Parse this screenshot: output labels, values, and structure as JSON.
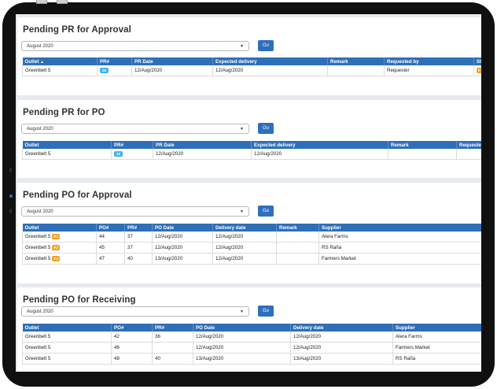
{
  "sections": [
    {
      "title": "Pending PR for Approval",
      "select_value": "August 2020",
      "go_label": "Go",
      "columns": [
        "Outlet",
        "PR#",
        "PR Date",
        "Expected delivery",
        "Remark",
        "Requested by",
        "Sta"
      ],
      "sort_arrow": "▲",
      "rows": [
        {
          "outlet": "Greenbelt 5",
          "pr_badge": "28",
          "pr_date": "12/Aug/2020",
          "expected": "12/Aug/2020",
          "remark": "",
          "requested_by": "Requester",
          "status_badge": "P"
        }
      ]
    },
    {
      "title": "Pending PR for PO",
      "select_value": "August 2020",
      "go_label": "Go",
      "columns": [
        "Outlet",
        "PR#",
        "PR Date",
        "Expected delivery",
        "Remark",
        "Requester"
      ],
      "rows": [
        {
          "outlet": "Greenbelt 5",
          "pr_badge": "28",
          "pr_date": "12/Aug/2020",
          "expected": "12/Aug/2020",
          "remark": "",
          "requester": ""
        }
      ]
    },
    {
      "title": "Pending PO for Approval",
      "select_value": "August 2020",
      "go_label": "Go",
      "columns": [
        "Outlet",
        "PO#",
        "PR#",
        "PO Date",
        "Delivery date",
        "Remark",
        "Supplier"
      ],
      "rows": [
        {
          "outlet": "Greenbelt 5",
          "badge": "PJ",
          "po": "44",
          "pr": "37",
          "po_date": "12/Aug/2020",
          "delivery": "12/Aug/2020",
          "remark": "",
          "supplier": "Alera Farms"
        },
        {
          "outlet": "Greenbelt 5",
          "badge": "PJ",
          "po": "45",
          "pr": "37",
          "po_date": "12/Aug/2020",
          "delivery": "12/Aug/2020",
          "remark": "",
          "supplier": "RS Raña"
        },
        {
          "outlet": "Greenbelt 5",
          "badge": "PJ",
          "po": "47",
          "pr": "40",
          "po_date": "13/Aug/2020",
          "delivery": "12/Aug/2020",
          "remark": "",
          "supplier": "Farmers Market"
        }
      ]
    },
    {
      "title": "Pending PO for Receiving",
      "select_value": "August 2020",
      "go_label": "Go",
      "columns": [
        "Outlet",
        "PO#",
        "PR#",
        "PO Date",
        "Delivery date",
        "Supplier"
      ],
      "rows": [
        {
          "outlet": "Greenbelt 5",
          "po": "42",
          "pr": "36",
          "po_date": "12/Aug/2020",
          "delivery": "12/Aug/2020",
          "supplier": "Alera Farms"
        },
        {
          "outlet": "Greenbelt 5",
          "po": "46",
          "pr": "",
          "po_date": "12/Aug/2020",
          "delivery": "12/Aug/2020",
          "supplier": "Farmers Market"
        },
        {
          "outlet": "Greenbelt 5",
          "po": "48",
          "pr": "40",
          "po_date": "13/Aug/2020",
          "delivery": "13/Aug/2020",
          "supplier": "RS Raña"
        }
      ]
    }
  ],
  "caret_icon": "▼",
  "colors": {
    "header_blue": "#2f6fb7",
    "go_button": "#2d6fbe",
    "badge_blue": "#3eb4e9",
    "badge_orange": "#f0a22c",
    "frame": "#101010"
  }
}
